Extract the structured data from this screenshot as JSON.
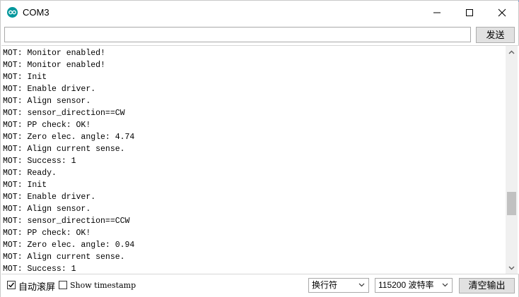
{
  "window": {
    "title": "COM3",
    "accent_color": "#1f6fd1",
    "icon_color": "#00979c"
  },
  "icons": [
    "app-logo-icon",
    "minimize-icon",
    "maximize-icon",
    "close-icon",
    "scroll-up-icon",
    "scroll-down-icon",
    "chevron-down-icon",
    "checkmark-icon"
  ],
  "input": {
    "value": "",
    "placeholder": ""
  },
  "send_label": "发送",
  "output": [
    "MOT: Monitor enabled!",
    "MOT: Monitor enabled!",
    "MOT: Init",
    "MOT: Enable driver.",
    "MOT: Align sensor.",
    "MOT: sensor_direction==CW",
    "MOT: PP check: OK!",
    "MOT: Zero elec. angle: 4.74",
    "MOT: Align current sense.",
    "MOT: Success: 1",
    "MOT: Ready.",
    "MOT: Init",
    "MOT: Enable driver.",
    "MOT: Align sensor.",
    "MOT: sensor_direction==CCW",
    "MOT: PP check: OK!",
    "MOT: Zero elec. angle: 0.94",
    "MOT: Align current sense.",
    "MOT: Success: 1"
  ],
  "bottom": {
    "autoscroll_label": "自动滚屏",
    "autoscroll_checked": true,
    "timestamp_label": "Show timestamp",
    "timestamp_checked": false,
    "line_ending": "换行符",
    "baud": "115200 波特率",
    "clear_label": "清空输出"
  }
}
